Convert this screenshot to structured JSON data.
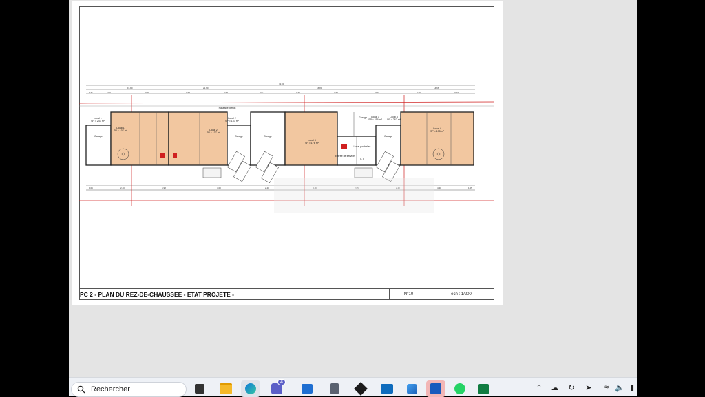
{
  "document": {
    "title": "PC 2 - PLAN DU REZ-DE-CHAUSSEE - ETAT PROJETE -",
    "sheet_number": "N°10",
    "scale": "ech : 1/200"
  },
  "plan": {
    "passage_label": "Passage piéton",
    "rooms": [
      {
        "name": "Local 1",
        "area": "SP = 247 m²"
      },
      {
        "name": "Local 1",
        "area": "SP = 107 m²"
      },
      {
        "name": "Local 2",
        "area": "SP = 107 m²"
      },
      {
        "name": "Local 2",
        "area": "SP = 157 m²"
      },
      {
        "name": "Local 3",
        "area": "SP = 176 m²"
      },
      {
        "name": "Local 3",
        "area": "SP = 116 m²"
      },
      {
        "name": "Local 4",
        "area": "SP = 262 m²"
      },
      {
        "name": "Local 4",
        "area": "SP = 135 m²"
      }
    ],
    "small_labels": [
      "Garage",
      "Garage",
      "Garage",
      "Garage",
      "Garage",
      "Local poubelles",
      "Entrée de service",
      "L.T"
    ]
  },
  "taskbar": {
    "search_placeholder": "Rechercher",
    "teams_badge": "4",
    "apps": [
      "file-explorer-icon",
      "edge-icon",
      "teams-icon",
      "store-icon",
      "calculator-icon",
      "app-icon",
      "outlook-icon",
      "photos-icon",
      "word-icon",
      "whatsapp-icon",
      "excel-icon"
    ]
  }
}
